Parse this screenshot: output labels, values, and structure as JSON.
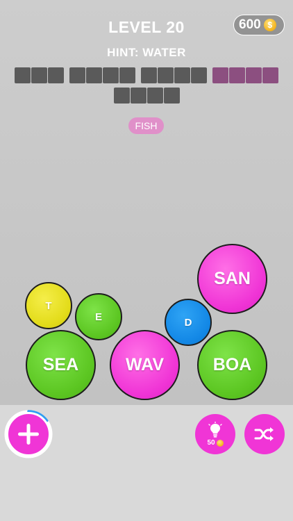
{
  "header": {
    "level": "LEVEL 20",
    "coins": "600",
    "coin_symbol": "$",
    "hint": "HINT: WATER"
  },
  "puzzle": {
    "row1_words": [
      {
        "length": 3,
        "solved": false
      },
      {
        "length": 4,
        "solved": false
      },
      {
        "length": 4,
        "solved": false
      },
      {
        "length": 4,
        "solved": true
      }
    ],
    "row2_words": [
      {
        "length": 4,
        "solved": false
      }
    ],
    "found_word": "FISH"
  },
  "balls": [
    {
      "label": "T",
      "color": "yellow"
    },
    {
      "label": "E",
      "color": "green"
    },
    {
      "label": "D",
      "color": "blue"
    },
    {
      "label": "SAN",
      "color": "pink"
    },
    {
      "label": "SEA",
      "color": "green"
    },
    {
      "label": "WAV",
      "color": "pink"
    },
    {
      "label": "BOA",
      "color": "green"
    }
  ],
  "controls": {
    "add_icon": "plus-icon",
    "hint_icon": "lightbulb-icon",
    "hint_cost": "50",
    "shuffle_icon": "shuffle-icon",
    "add_progress": 0.15
  },
  "colors": {
    "pink": "#f035d6",
    "green": "#5cc622",
    "yellow": "#e3dc1a",
    "blue": "#1388e6",
    "slot": "#5a5a5a",
    "slot_solved": "#8c4f80"
  }
}
